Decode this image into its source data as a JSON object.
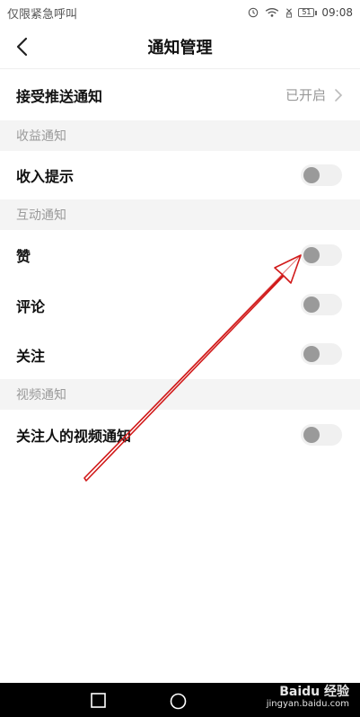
{
  "status_bar": {
    "carrier": "仅限紧急呼叫",
    "battery": "51",
    "time": "09:08"
  },
  "nav": {
    "title": "通知管理"
  },
  "push": {
    "label": "接受推送通知",
    "value": "已开启"
  },
  "sections": {
    "income": {
      "header": "收益通知",
      "items": [
        {
          "label": "收入提示",
          "enabled": false
        }
      ]
    },
    "interaction": {
      "header": "互动通知",
      "items": [
        {
          "label": "赞",
          "enabled": false
        },
        {
          "label": "评论",
          "enabled": false
        },
        {
          "label": "关注",
          "enabled": false
        }
      ]
    },
    "video": {
      "header": "视频通知",
      "items": [
        {
          "label": "关注人的视频通知",
          "enabled": false
        }
      ]
    }
  },
  "watermark": {
    "logo": "Baidu 经验",
    "url": "jingyan.baidu.com"
  },
  "colors": {
    "annotation_arrow": "#d11a1a",
    "toggle_track": "#f0f0f0",
    "toggle_knob": "#9a9a9a",
    "section_bg": "#f4f4f4"
  }
}
